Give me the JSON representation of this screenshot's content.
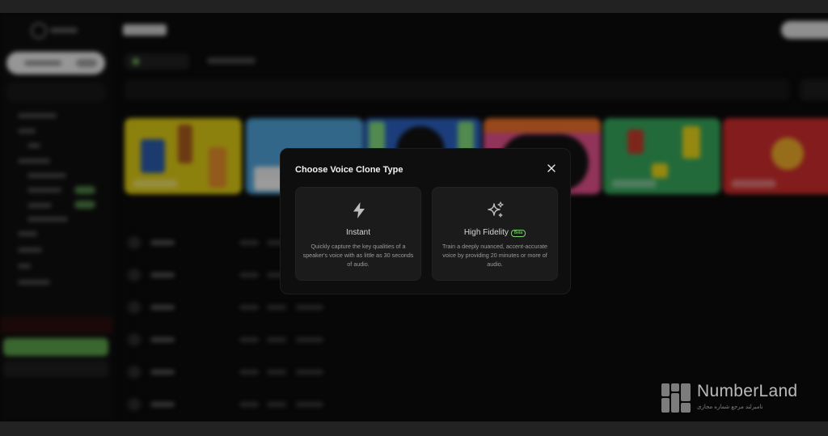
{
  "modal": {
    "title": "Choose Voice Clone Type",
    "close_icon": "close-icon",
    "options": [
      {
        "icon": "lightning-icon",
        "name": "Instant",
        "description": "Quickly capture the key qualities of a speaker's voice with as little as 30 seconds of audio."
      },
      {
        "icon": "sparkles-icon",
        "name": "High Fidelity",
        "badge": "Beta",
        "description": "Train a deeply nuanced, accent-accurate voice by providing 20 minutes or more of audio."
      }
    ]
  },
  "watermark": {
    "name": "NumberLand",
    "tagline": "نامبرلند مرجع شماره مجازی"
  },
  "colors": {
    "modal_bg": "#0e0e0e",
    "card_bg": "#1b1b1b",
    "beta_green": "#7bd36c",
    "sidebar_accent_green": "#5a9e4a"
  }
}
